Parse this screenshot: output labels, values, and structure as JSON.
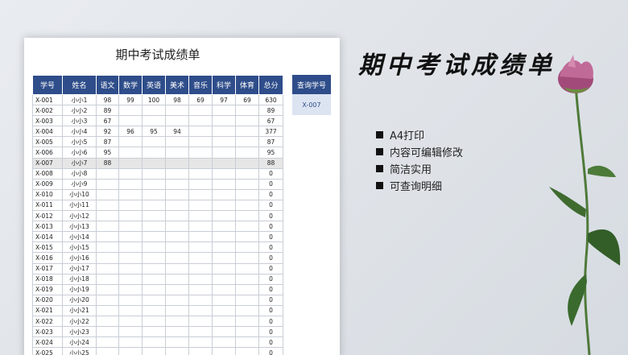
{
  "sheet": {
    "title": "期中考试成绩单",
    "headers": [
      "学号",
      "姓名",
      "语文",
      "数学",
      "英语",
      "美术",
      "音乐",
      "科学",
      "体育",
      "总分"
    ],
    "rows": [
      [
        "X-001",
        "小小1",
        "98",
        "99",
        "100",
        "98",
        "69",
        "97",
        "69",
        "630"
      ],
      [
        "X-002",
        "小小2",
        "89",
        "",
        "",
        "",
        "",
        "",
        "",
        "89"
      ],
      [
        "X-003",
        "小小3",
        "67",
        "",
        "",
        "",
        "",
        "",
        "",
        "67"
      ],
      [
        "X-004",
        "小小4",
        "92",
        "96",
        "95",
        "94",
        "",
        "",
        "",
        "377"
      ],
      [
        "X-005",
        "小小5",
        "87",
        "",
        "",
        "",
        "",
        "",
        "",
        "87"
      ],
      [
        "X-006",
        "小小6",
        "95",
        "",
        "",
        "",
        "",
        "",
        "",
        "95"
      ],
      [
        "X-007",
        "小小7",
        "88",
        "",
        "",
        "",
        "",
        "",
        "",
        "88"
      ],
      [
        "X-008",
        "小小8",
        "",
        "",
        "",
        "",
        "",
        "",
        "",
        "0"
      ],
      [
        "X-009",
        "小小9",
        "",
        "",
        "",
        "",
        "",
        "",
        "",
        "0"
      ],
      [
        "X-010",
        "小小10",
        "",
        "",
        "",
        "",
        "",
        "",
        "",
        "0"
      ],
      [
        "X-011",
        "小小11",
        "",
        "",
        "",
        "",
        "",
        "",
        "",
        "0"
      ],
      [
        "X-012",
        "小小12",
        "",
        "",
        "",
        "",
        "",
        "",
        "",
        "0"
      ],
      [
        "X-013",
        "小小13",
        "",
        "",
        "",
        "",
        "",
        "",
        "",
        "0"
      ],
      [
        "X-014",
        "小小14",
        "",
        "",
        "",
        "",
        "",
        "",
        "",
        "0"
      ],
      [
        "X-015",
        "小小15",
        "",
        "",
        "",
        "",
        "",
        "",
        "",
        "0"
      ],
      [
        "X-016",
        "小小16",
        "",
        "",
        "",
        "",
        "",
        "",
        "",
        "0"
      ],
      [
        "X-017",
        "小小17",
        "",
        "",
        "",
        "",
        "",
        "",
        "",
        "0"
      ],
      [
        "X-018",
        "小小18",
        "",
        "",
        "",
        "",
        "",
        "",
        "",
        "0"
      ],
      [
        "X-019",
        "小小19",
        "",
        "",
        "",
        "",
        "",
        "",
        "",
        "0"
      ],
      [
        "X-020",
        "小小20",
        "",
        "",
        "",
        "",
        "",
        "",
        "",
        "0"
      ],
      [
        "X-021",
        "小小21",
        "",
        "",
        "",
        "",
        "",
        "",
        "",
        "0"
      ],
      [
        "X-022",
        "小小22",
        "",
        "",
        "",
        "",
        "",
        "",
        "",
        "0"
      ],
      [
        "X-023",
        "小小23",
        "",
        "",
        "",
        "",
        "",
        "",
        "",
        "0"
      ],
      [
        "X-024",
        "小小24",
        "",
        "",
        "",
        "",
        "",
        "",
        "",
        "0"
      ],
      [
        "X-025",
        "小小25",
        "",
        "",
        "",
        "",
        "",
        "",
        "",
        "0"
      ]
    ],
    "highlight_row": "X-007"
  },
  "query": {
    "label": "查询学号",
    "value": "X-007"
  },
  "promo": {
    "title": "期中考试成绩单",
    "features": [
      "A4打印",
      "内容可编辑修改",
      "简洁实用",
      "可查询明细"
    ]
  },
  "colors": {
    "header_bg": "#2e4d8a",
    "query_bg": "#dce4f2",
    "highlight_bg": "#e6e6e6"
  },
  "icons": [
    "flower-decoration",
    "square-bullet-icon"
  ]
}
